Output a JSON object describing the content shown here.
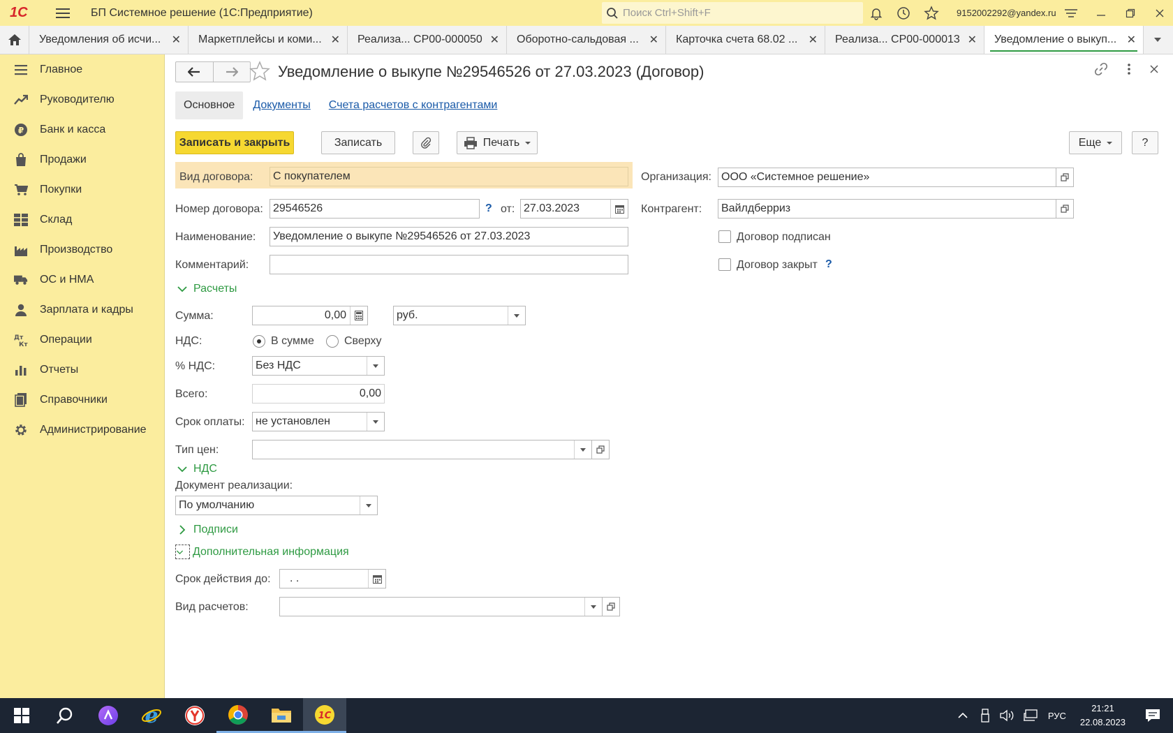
{
  "titlebar": {
    "app_title": "БП Системное решение  (1С:Предприятие)",
    "search_placeholder": "Поиск Ctrl+Shift+F",
    "user": "9152002292@yandex.ru"
  },
  "tabs": [
    {
      "label": "Уведомления об исчи...",
      "active": false
    },
    {
      "label": "Маркетплейсы и коми...",
      "active": false
    },
    {
      "label": "Реализа... СР00-000050",
      "active": false
    },
    {
      "label": "Оборотно-сальдовая ...",
      "active": false
    },
    {
      "label": "Карточка счета 68.02 ...",
      "active": false
    },
    {
      "label": "Реализа... СР00-000013",
      "active": false
    },
    {
      "label": "Уведомление о выкуп...",
      "active": true
    }
  ],
  "sidebar": {
    "items": [
      {
        "label": "Главное",
        "icon": "menu-icon"
      },
      {
        "label": "Руководителю",
        "icon": "chart-trend-icon"
      },
      {
        "label": "Банк и касса",
        "icon": "ruble-icon"
      },
      {
        "label": "Продажи",
        "icon": "shopping-bag-icon"
      },
      {
        "label": "Покупки",
        "icon": "cart-icon"
      },
      {
        "label": "Склад",
        "icon": "warehouse-icon"
      },
      {
        "label": "Производство",
        "icon": "factory-icon"
      },
      {
        "label": "ОС и НМА",
        "icon": "truck-icon"
      },
      {
        "label": "Зарплата и кадры",
        "icon": "person-icon"
      },
      {
        "label": "Операции",
        "icon": "debit-credit-icon"
      },
      {
        "label": "Отчеты",
        "icon": "bar-chart-icon"
      },
      {
        "label": "Справочники",
        "icon": "books-icon"
      },
      {
        "label": "Администрирование",
        "icon": "gear-icon"
      }
    ]
  },
  "document": {
    "title": "Уведомление о выкупе №29546526 от 27.03.2023 (Договор)",
    "subtabs": [
      "Основное",
      "Документы",
      "Счета расчетов с контрагентами"
    ]
  },
  "toolbar": {
    "save_close": "Записать и закрыть",
    "save": "Записать",
    "print": "Печать",
    "more": "Еще",
    "help": "?"
  },
  "form": {
    "contract_type_label": "Вид договора:",
    "contract_type": "С покупателем",
    "number_label": "Номер договора:",
    "number": "29546526",
    "date_label": "от:",
    "date": "27.03.2023",
    "name_label": "Наименование:",
    "name": "Уведомление о выкупе №29546526 от 27.03.2023",
    "comment_label": "Комментарий:",
    "comment": "",
    "org_label": "Организация:",
    "org": "ООО «Системное решение»",
    "counterparty_label": "Контрагент:",
    "counterparty": "Вайлдберриз",
    "signed_label": "Договор подписан",
    "closed_label": "Договор закрыт",
    "q": "?"
  },
  "calc": {
    "section": "Расчеты",
    "sum_label": "Сумма:",
    "sum": "0,00",
    "currency": "руб.",
    "vat_label": "НДС:",
    "vat_in": "В сумме",
    "vat_over": "Сверху",
    "vat_rate_label": "% НДС:",
    "vat_rate": "Без НДС",
    "total_label": "Всего:",
    "total": "0,00",
    "term_label": "Срок оплаты:",
    "term": "не установлен",
    "price_type_label": "Тип цен:",
    "price_type": ""
  },
  "vat": {
    "section": "НДС",
    "doc_label": "Документ реализации:",
    "doc": "По умолчанию"
  },
  "signs": {
    "section": "Подписи"
  },
  "extra": {
    "section": "Дополнительная информация",
    "valid_label": "Срок действия до:",
    "valid": " .  .",
    "calc_type_label": "Вид расчетов:",
    "calc_type": ""
  },
  "taskbar": {
    "lang": "РУС",
    "time": "21:21",
    "date": "22.08.2023"
  }
}
